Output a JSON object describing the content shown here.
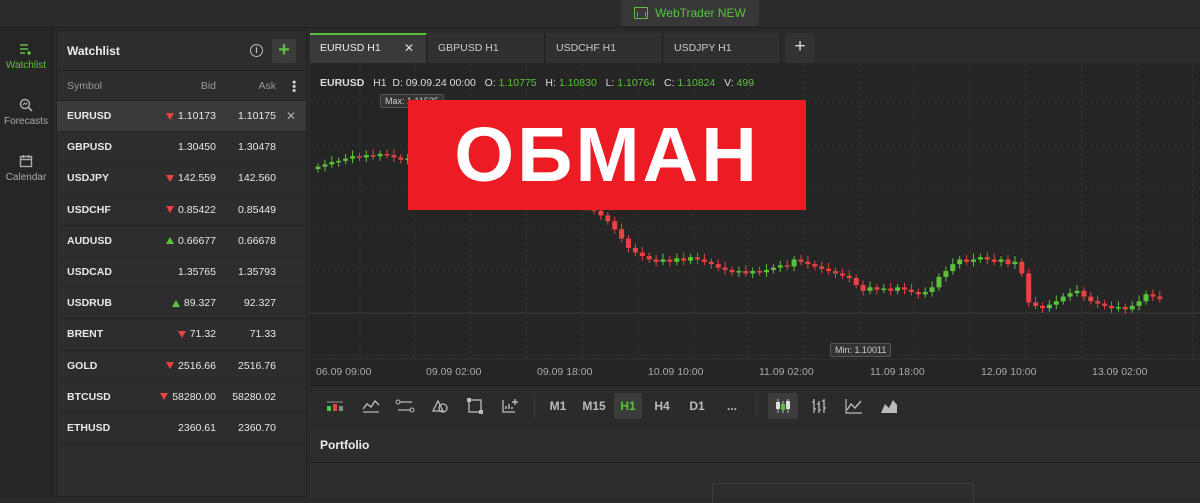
{
  "brand": {
    "label": "WebTrader NEW",
    "icon": "webtrader-icon"
  },
  "nav": [
    {
      "label": "Watchlist",
      "icon": "watchlist-icon",
      "active": true
    },
    {
      "label": "Forecasts",
      "icon": "forecasts-icon",
      "active": false
    },
    {
      "label": "Calendar",
      "icon": "calendar-icon",
      "active": false
    }
  ],
  "watchlist": {
    "title": "Watchlist",
    "add": "+",
    "info": "i",
    "cols": {
      "symbol": "Symbol",
      "bid": "Bid",
      "ask": "Ask"
    },
    "rows": [
      {
        "sym": "EURUSD",
        "bid": "1.10173",
        "ask": "1.10175",
        "dir": "down"
      },
      {
        "sym": "GBPUSD",
        "bid": "1.30450",
        "ask": "1.30478",
        "dir": "none"
      },
      {
        "sym": "USDJPY",
        "bid": "142.559",
        "ask": "142.560",
        "dir": "down"
      },
      {
        "sym": "USDCHF",
        "bid": "0.85422",
        "ask": "0.85449",
        "dir": "down"
      },
      {
        "sym": "AUDUSD",
        "bid": "0.66677",
        "ask": "0.66678",
        "dir": "up"
      },
      {
        "sym": "USDCAD",
        "bid": "1.35765",
        "ask": "1.35793",
        "dir": "none"
      },
      {
        "sym": "USDRUB",
        "bid": "89.327",
        "ask": "92.327",
        "dir": "up"
      },
      {
        "sym": "BRENT",
        "bid": "71.32",
        "ask": "71.33",
        "dir": "down"
      },
      {
        "sym": "GOLD",
        "bid": "2516.66",
        "ask": "2516.76",
        "dir": "down"
      },
      {
        "sym": "BTCUSD",
        "bid": "58280.00",
        "ask": "58280.02",
        "dir": "down"
      },
      {
        "sym": "ETHUSD",
        "bid": "2360.61",
        "ask": "2360.70",
        "dir": "none"
      }
    ]
  },
  "tabs": [
    {
      "label": "EURUSD H1",
      "active": true
    },
    {
      "label": "GBPUSD H1",
      "active": false
    },
    {
      "label": "USDCHF H1",
      "active": false
    },
    {
      "label": "USDJPY H1",
      "active": false
    }
  ],
  "tab_add": "+",
  "tab_close": "✕",
  "chart_info": {
    "sym": "EURUSD",
    "tf": "H1",
    "d_label": "D:",
    "d": "09.09.24 00:00",
    "o_label": "O:",
    "o": "1.10775",
    "h_label": "H:",
    "h": "1.10830",
    "l_label": "L:",
    "l": "1.10764",
    "c_label": "C:",
    "c": "1.10824",
    "v_label": "V:",
    "v": "499"
  },
  "overlay": {
    "text": "ОБМАН",
    "color": "#ed1c24"
  },
  "chart_data": {
    "type": "candlestick",
    "x_ticks": [
      "06.09 09:00",
      "09.09 02:00",
      "09.09 18:00",
      "10.09 10:00",
      "11.09 02:00",
      "11.09 18:00",
      "12.09 10:00",
      "13.09 02:00"
    ],
    "max_label": "Max: 1.11535",
    "min_label": "Min: 1.10011",
    "ylim": [
      1.10011,
      1.11535
    ],
    "up_color": "#5cc23e",
    "down_color": "#e84242",
    "close": [
      1.1052,
      1.1054,
      1.1056,
      1.1057,
      1.1059,
      1.1061,
      1.106,
      1.1062,
      1.1061,
      1.1063,
      1.1062,
      1.106,
      1.1058,
      1.1059,
      1.1057,
      1.104,
      1.1072,
      1.108,
      1.105,
      1.102,
      1.1028,
      1.1045,
      1.1035,
      1.103,
      1.1025,
      1.1032,
      1.1028,
      1.1035,
      1.104,
      1.1045,
      1.1038,
      1.103,
      1.1027,
      1.1024,
      1.1022,
      1.1025,
      1.1028,
      1.1025,
      1.1022,
      1.1018,
      1.1014,
      1.101,
      1.1005,
      1.0998,
      1.099,
      1.0982,
      1.0978,
      1.0975,
      1.0972,
      1.097,
      1.0972,
      1.097,
      1.0973,
      1.0971,
      1.0974,
      1.0972,
      1.097,
      1.0968,
      1.0965,
      1.0963,
      1.0961,
      1.0962,
      1.096,
      1.0962,
      1.0961,
      1.0963,
      1.0965,
      1.0967,
      1.0966,
      1.0972,
      1.097,
      1.0968,
      1.0966,
      1.0964,
      1.0962,
      1.096,
      1.0958,
      1.0956,
      1.095,
      1.0945,
      1.0948,
      1.0946,
      1.0947,
      1.0945,
      1.0948,
      1.0946,
      1.0944,
      1.0942,
      1.0944,
      1.0948,
      1.0957,
      1.0962,
      1.0968,
      1.0972,
      1.097,
      1.0972,
      1.0974,
      1.0972,
      1.097,
      1.0972,
      1.0968,
      1.097,
      1.096,
      1.0935,
      1.0932,
      1.093,
      1.0933,
      1.0936,
      1.094,
      1.0943,
      1.0945,
      1.094,
      1.0936,
      1.0934,
      1.0932,
      1.093,
      1.0931,
      1.0929,
      1.0932,
      1.0936,
      1.0942,
      1.094,
      1.0938
    ]
  },
  "toolbar": {
    "timeframes": [
      "M1",
      "M15",
      "H1",
      "H4",
      "D1",
      "..."
    ],
    "active_tf": "H1",
    "tools": [
      "indicators-icon",
      "line-studies-icon",
      "trend-tool-icon",
      "shapes-icon",
      "select-area-icon",
      "add-chart-icon"
    ],
    "chart_types": [
      "candles-icon",
      "bars-icon",
      "line-chart-icon",
      "area-chart-icon"
    ],
    "active_type": "candles-icon"
  },
  "portfolio": {
    "title": "Portfolio"
  }
}
